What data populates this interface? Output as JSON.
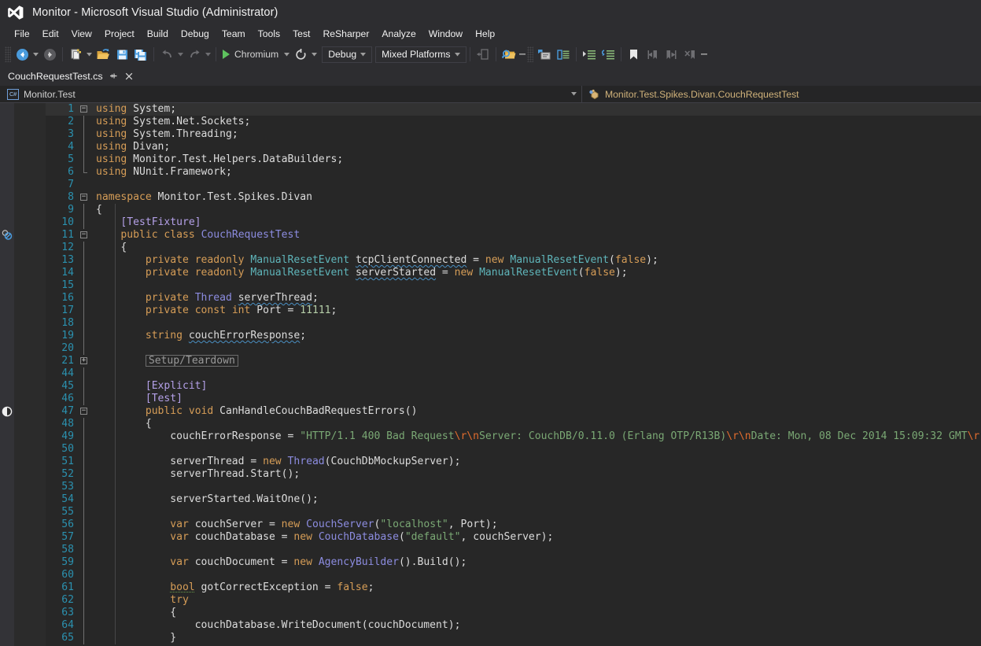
{
  "window": {
    "title": "Monitor - Microsoft Visual Studio (Administrator)",
    "logo_icon": "visual-studio-logo-icon"
  },
  "menubar": {
    "items": [
      {
        "label": "File"
      },
      {
        "label": "Edit"
      },
      {
        "label": "View"
      },
      {
        "label": "Project"
      },
      {
        "label": "Build"
      },
      {
        "label": "Debug"
      },
      {
        "label": "Team"
      },
      {
        "label": "Tools"
      },
      {
        "label": "Test"
      },
      {
        "label": "ReSharper"
      },
      {
        "label": "Analyze"
      },
      {
        "label": "Window"
      },
      {
        "label": "Help"
      }
    ]
  },
  "toolbar": {
    "navigate_back_icon": "navigate-back-icon",
    "navigate_forward_icon": "navigate-forward-icon",
    "new_item_icon": "new-item-icon",
    "open_file_icon": "open-file-icon",
    "save_icon": "save-icon",
    "save_all_icon": "save-all-icon",
    "undo_icon": "undo-icon",
    "redo_icon": "redo-icon",
    "start_label": "Chromium",
    "restart_icon": "restart-icon",
    "configuration": "Debug",
    "platform": "Mixed Platforms",
    "step_into_icon": "step-into-specific-icon",
    "find_in_files_icon": "find-in-files-icon",
    "comment_icon": "comment-selection-icon",
    "uncomment_icon": "uncomment-selection-icon",
    "indent_icon": "increase-indent-icon",
    "outdent_icon": "decrease-indent-icon",
    "bookmark_icon": "toggle-bookmark-icon",
    "prev_bookmark_icon": "previous-bookmark-icon",
    "next_bookmark_icon": "next-bookmark-icon",
    "clear_bookmarks_icon": "clear-bookmarks-icon"
  },
  "tab": {
    "label": "CouchRequestTest.cs",
    "pin_icon": "pin-icon",
    "close_icon": "close-icon"
  },
  "navbar": {
    "project": "Monitor.Test",
    "project_icon": "csharp-project-icon",
    "member": "Monitor.Test.Spikes.Divan.CouchRequestTest",
    "member_icon": "class-icon",
    "dropdown_icon": "chevron-down-icon"
  },
  "editor": {
    "margin_icons": [
      {
        "line": 11,
        "icon": "unit-test-session-icon"
      },
      {
        "line": 47,
        "icon": "unit-test-status-icon"
      }
    ],
    "lines": [
      {
        "n": 1,
        "fold": "minus",
        "current": true,
        "tokens": [
          {
            "t": "using",
            "c": "kw"
          },
          {
            "t": " System;",
            "c": "id"
          }
        ]
      },
      {
        "n": 2,
        "fold": "bar",
        "tokens": [
          {
            "t": "using",
            "c": "kw"
          },
          {
            "t": " System.Net.Sockets;",
            "c": "id"
          }
        ]
      },
      {
        "n": 3,
        "fold": "bar",
        "tokens": [
          {
            "t": "using",
            "c": "kw"
          },
          {
            "t": " System.Threading;",
            "c": "id"
          }
        ]
      },
      {
        "n": 4,
        "fold": "bar",
        "tokens": [
          {
            "t": "using",
            "c": "kw"
          },
          {
            "t": " Divan;",
            "c": "id"
          }
        ]
      },
      {
        "n": 5,
        "fold": "bar",
        "tokens": [
          {
            "t": "using",
            "c": "kw"
          },
          {
            "t": " Monitor.Test.Helpers.DataBuilders;",
            "c": "id"
          }
        ]
      },
      {
        "n": 6,
        "fold": "end",
        "tokens": [
          {
            "t": "using",
            "c": "kw"
          },
          {
            "t": " NUnit.Framework;",
            "c": "id"
          }
        ]
      },
      {
        "n": 7,
        "fold": "none",
        "tokens": []
      },
      {
        "n": 8,
        "fold": "minus",
        "tokens": [
          {
            "t": "namespace",
            "c": "kw"
          },
          {
            "t": " Monitor.Test.Spikes.Divan",
            "c": "id"
          }
        ]
      },
      {
        "n": 9,
        "fold": "bar",
        "tokens": [
          {
            "t": "{",
            "c": "punc"
          }
        ]
      },
      {
        "n": 10,
        "fold": "bar",
        "tokens": [
          {
            "t": "    ",
            "c": "id"
          },
          {
            "t": "[TestFixture]",
            "c": "attr"
          }
        ]
      },
      {
        "n": 11,
        "fold": "minus",
        "tokens": [
          {
            "t": "    ",
            "c": "id"
          },
          {
            "t": "public",
            "c": "kw"
          },
          {
            "t": " ",
            "c": "id"
          },
          {
            "t": "class",
            "c": "kw"
          },
          {
            "t": " ",
            "c": "id"
          },
          {
            "t": "CouchRequestTest",
            "c": "typ"
          }
        ]
      },
      {
        "n": 12,
        "fold": "bar",
        "tokens": [
          {
            "t": "    {",
            "c": "punc"
          }
        ]
      },
      {
        "n": 13,
        "fold": "bar",
        "tokens": [
          {
            "t": "        ",
            "c": "id"
          },
          {
            "t": "private",
            "c": "kw"
          },
          {
            "t": " ",
            "c": "id"
          },
          {
            "t": "readonly",
            "c": "kw"
          },
          {
            "t": " ",
            "c": "id"
          },
          {
            "t": "ManualResetEvent",
            "c": "typ2"
          },
          {
            "t": " ",
            "c": "id"
          },
          {
            "t": "tcpClientConnected",
            "c": "id sq"
          },
          {
            "t": " = ",
            "c": "punc"
          },
          {
            "t": "new",
            "c": "kw"
          },
          {
            "t": " ",
            "c": "id"
          },
          {
            "t": "ManualResetEvent",
            "c": "typ2"
          },
          {
            "t": "(",
            "c": "punc"
          },
          {
            "t": "false",
            "c": "kw"
          },
          {
            "t": ");",
            "c": "punc"
          }
        ]
      },
      {
        "n": 14,
        "fold": "bar",
        "tokens": [
          {
            "t": "        ",
            "c": "id"
          },
          {
            "t": "private",
            "c": "kw"
          },
          {
            "t": " ",
            "c": "id"
          },
          {
            "t": "readonly",
            "c": "kw"
          },
          {
            "t": " ",
            "c": "id"
          },
          {
            "t": "ManualResetEvent",
            "c": "typ2"
          },
          {
            "t": " ",
            "c": "id"
          },
          {
            "t": "serverStarted",
            "c": "id sq"
          },
          {
            "t": " = ",
            "c": "punc"
          },
          {
            "t": "new",
            "c": "kw"
          },
          {
            "t": " ",
            "c": "id"
          },
          {
            "t": "ManualResetEvent",
            "c": "typ2"
          },
          {
            "t": "(",
            "c": "punc"
          },
          {
            "t": "false",
            "c": "kw"
          },
          {
            "t": ");",
            "c": "punc"
          }
        ]
      },
      {
        "n": 15,
        "fold": "bar",
        "tokens": []
      },
      {
        "n": 16,
        "fold": "bar",
        "tokens": [
          {
            "t": "        ",
            "c": "id"
          },
          {
            "t": "private",
            "c": "kw"
          },
          {
            "t": " ",
            "c": "id"
          },
          {
            "t": "Thread",
            "c": "typ"
          },
          {
            "t": " ",
            "c": "id"
          },
          {
            "t": "serverThread",
            "c": "id sq"
          },
          {
            "t": ";",
            "c": "punc"
          }
        ]
      },
      {
        "n": 17,
        "fold": "bar",
        "tokens": [
          {
            "t": "        ",
            "c": "id"
          },
          {
            "t": "private",
            "c": "kw"
          },
          {
            "t": " ",
            "c": "id"
          },
          {
            "t": "const",
            "c": "kw"
          },
          {
            "t": " ",
            "c": "id"
          },
          {
            "t": "int",
            "c": "kw"
          },
          {
            "t": " Port = ",
            "c": "id"
          },
          {
            "t": "11111",
            "c": "num"
          },
          {
            "t": ";",
            "c": "punc"
          }
        ]
      },
      {
        "n": 18,
        "fold": "bar",
        "tokens": []
      },
      {
        "n": 19,
        "fold": "bar",
        "tokens": [
          {
            "t": "        ",
            "c": "id"
          },
          {
            "t": "string",
            "c": "kw"
          },
          {
            "t": " ",
            "c": "id"
          },
          {
            "t": "couchErrorResponse",
            "c": "id sq"
          },
          {
            "t": ";",
            "c": "punc"
          }
        ]
      },
      {
        "n": 20,
        "fold": "bar",
        "tokens": []
      },
      {
        "n": 21,
        "fold": "plus",
        "collapsed": "Setup/Teardown",
        "tokens": []
      },
      {
        "n": 44,
        "fold": "bar",
        "tokens": []
      },
      {
        "n": 45,
        "fold": "bar",
        "tokens": [
          {
            "t": "        ",
            "c": "id"
          },
          {
            "t": "[Explicit]",
            "c": "attr"
          }
        ]
      },
      {
        "n": 46,
        "fold": "bar",
        "tokens": [
          {
            "t": "        ",
            "c": "id"
          },
          {
            "t": "[Test]",
            "c": "attr"
          }
        ]
      },
      {
        "n": 47,
        "fold": "minus",
        "tokens": [
          {
            "t": "        ",
            "c": "id"
          },
          {
            "t": "public",
            "c": "kw"
          },
          {
            "t": " ",
            "c": "id"
          },
          {
            "t": "void",
            "c": "kw"
          },
          {
            "t": " CanHandleCouchBadRequestErrors()",
            "c": "id"
          }
        ]
      },
      {
        "n": 48,
        "fold": "bar",
        "tokens": [
          {
            "t": "        {",
            "c": "punc"
          }
        ]
      },
      {
        "n": 49,
        "fold": "bar",
        "tokens": [
          {
            "t": "            couchErrorResponse = ",
            "c": "id"
          },
          {
            "t": "\"HTTP/1.1 400 Bad Request",
            "c": "str"
          },
          {
            "t": "\\r\\n",
            "c": "esc"
          },
          {
            "t": "Server: CouchDB/0.11.0 (Erlang OTP/R13B)",
            "c": "str"
          },
          {
            "t": "\\r\\n",
            "c": "esc"
          },
          {
            "t": "Date: Mon, 08 Dec 2014 15:09:32 GMT",
            "c": "str"
          },
          {
            "t": "\\r",
            "c": "esc"
          }
        ]
      },
      {
        "n": 50,
        "fold": "bar",
        "tokens": []
      },
      {
        "n": 51,
        "fold": "bar",
        "tokens": [
          {
            "t": "            serverThread = ",
            "c": "id"
          },
          {
            "t": "new",
            "c": "kw"
          },
          {
            "t": " ",
            "c": "id"
          },
          {
            "t": "Thread",
            "c": "typ"
          },
          {
            "t": "(CouchDbMockupServer);",
            "c": "id"
          }
        ]
      },
      {
        "n": 52,
        "fold": "bar",
        "tokens": [
          {
            "t": "            serverThread.Start();",
            "c": "id"
          }
        ]
      },
      {
        "n": 53,
        "fold": "bar",
        "tokens": []
      },
      {
        "n": 54,
        "fold": "bar",
        "tokens": [
          {
            "t": "            serverStarted.WaitOne();",
            "c": "id"
          }
        ]
      },
      {
        "n": 55,
        "fold": "bar",
        "tokens": []
      },
      {
        "n": 56,
        "fold": "bar",
        "tokens": [
          {
            "t": "            ",
            "c": "id"
          },
          {
            "t": "var",
            "c": "kw"
          },
          {
            "t": " couchServer = ",
            "c": "id"
          },
          {
            "t": "new",
            "c": "kw"
          },
          {
            "t": " ",
            "c": "id"
          },
          {
            "t": "CouchServer",
            "c": "typ"
          },
          {
            "t": "(",
            "c": "punc"
          },
          {
            "t": "\"localhost\"",
            "c": "str"
          },
          {
            "t": ", Port);",
            "c": "id"
          }
        ]
      },
      {
        "n": 57,
        "fold": "bar",
        "tokens": [
          {
            "t": "            ",
            "c": "id"
          },
          {
            "t": "var",
            "c": "kw"
          },
          {
            "t": " couchDatabase = ",
            "c": "id"
          },
          {
            "t": "new",
            "c": "kw"
          },
          {
            "t": " ",
            "c": "id"
          },
          {
            "t": "CouchDatabase",
            "c": "typ"
          },
          {
            "t": "(",
            "c": "punc"
          },
          {
            "t": "\"default\"",
            "c": "str"
          },
          {
            "t": ", couchServer);",
            "c": "id"
          }
        ]
      },
      {
        "n": 58,
        "fold": "bar",
        "tokens": []
      },
      {
        "n": 59,
        "fold": "bar",
        "tokens": [
          {
            "t": "            ",
            "c": "id"
          },
          {
            "t": "var",
            "c": "kw"
          },
          {
            "t": " couchDocument = ",
            "c": "id"
          },
          {
            "t": "new",
            "c": "kw"
          },
          {
            "t": " ",
            "c": "id"
          },
          {
            "t": "AgencyBuilder",
            "c": "typ"
          },
          {
            "t": "().Build();",
            "c": "id"
          }
        ]
      },
      {
        "n": 60,
        "fold": "bar",
        "tokens": []
      },
      {
        "n": 61,
        "fold": "bar",
        "tokens": [
          {
            "t": "            ",
            "c": "id"
          },
          {
            "t": "bool",
            "c": "kw sq-g"
          },
          {
            "t": " gotCorrectException = ",
            "c": "id"
          },
          {
            "t": "false",
            "c": "kw"
          },
          {
            "t": ";",
            "c": "punc"
          }
        ]
      },
      {
        "n": 62,
        "fold": "bar",
        "tokens": [
          {
            "t": "            ",
            "c": "id"
          },
          {
            "t": "try",
            "c": "kw"
          }
        ]
      },
      {
        "n": 63,
        "fold": "bar",
        "tokens": [
          {
            "t": "            {",
            "c": "punc"
          }
        ]
      },
      {
        "n": 64,
        "fold": "bar",
        "tokens": [
          {
            "t": "                couchDatabase.WriteDocument(couchDocument);",
            "c": "id"
          }
        ]
      },
      {
        "n": 65,
        "fold": "bar",
        "tokens": [
          {
            "t": "            }",
            "c": "punc"
          }
        ]
      }
    ]
  }
}
